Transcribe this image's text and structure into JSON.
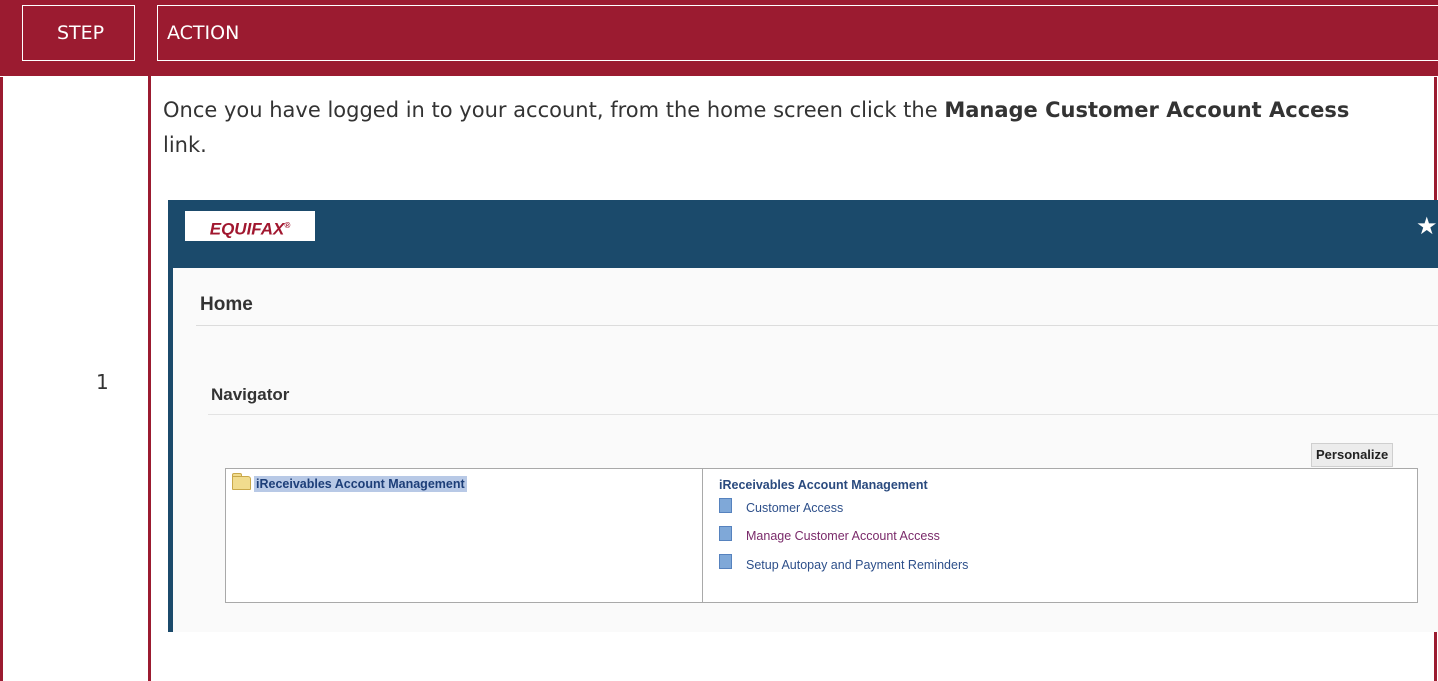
{
  "table": {
    "header": {
      "step": "STEP",
      "action": "ACTION"
    },
    "rows": [
      {
        "step": "1",
        "instruction": {
          "before": "Once you have logged in to your account, from the home screen click the ",
          "bold": "Manage Customer Account Access",
          "after": " link."
        }
      }
    ]
  },
  "screenshot": {
    "logo_text": "EQUIFAX",
    "logo_mark": "®",
    "page_title": "Home",
    "section_title": "Navigator",
    "personalize_label": "Personalize",
    "tree_item": "iReceivables Account Management",
    "group_title": "iReceivables Account Management",
    "links": [
      "Customer Access",
      "Manage Customer Account Access",
      "Setup Autopay and Payment Reminders"
    ]
  },
  "colors": {
    "header_bg": "#9b1b30",
    "banner_bg": "#1b4a6b",
    "logo_red": "#a1172f"
  },
  "icons": [
    "star-icon",
    "folder-icon",
    "document-icon"
  ]
}
